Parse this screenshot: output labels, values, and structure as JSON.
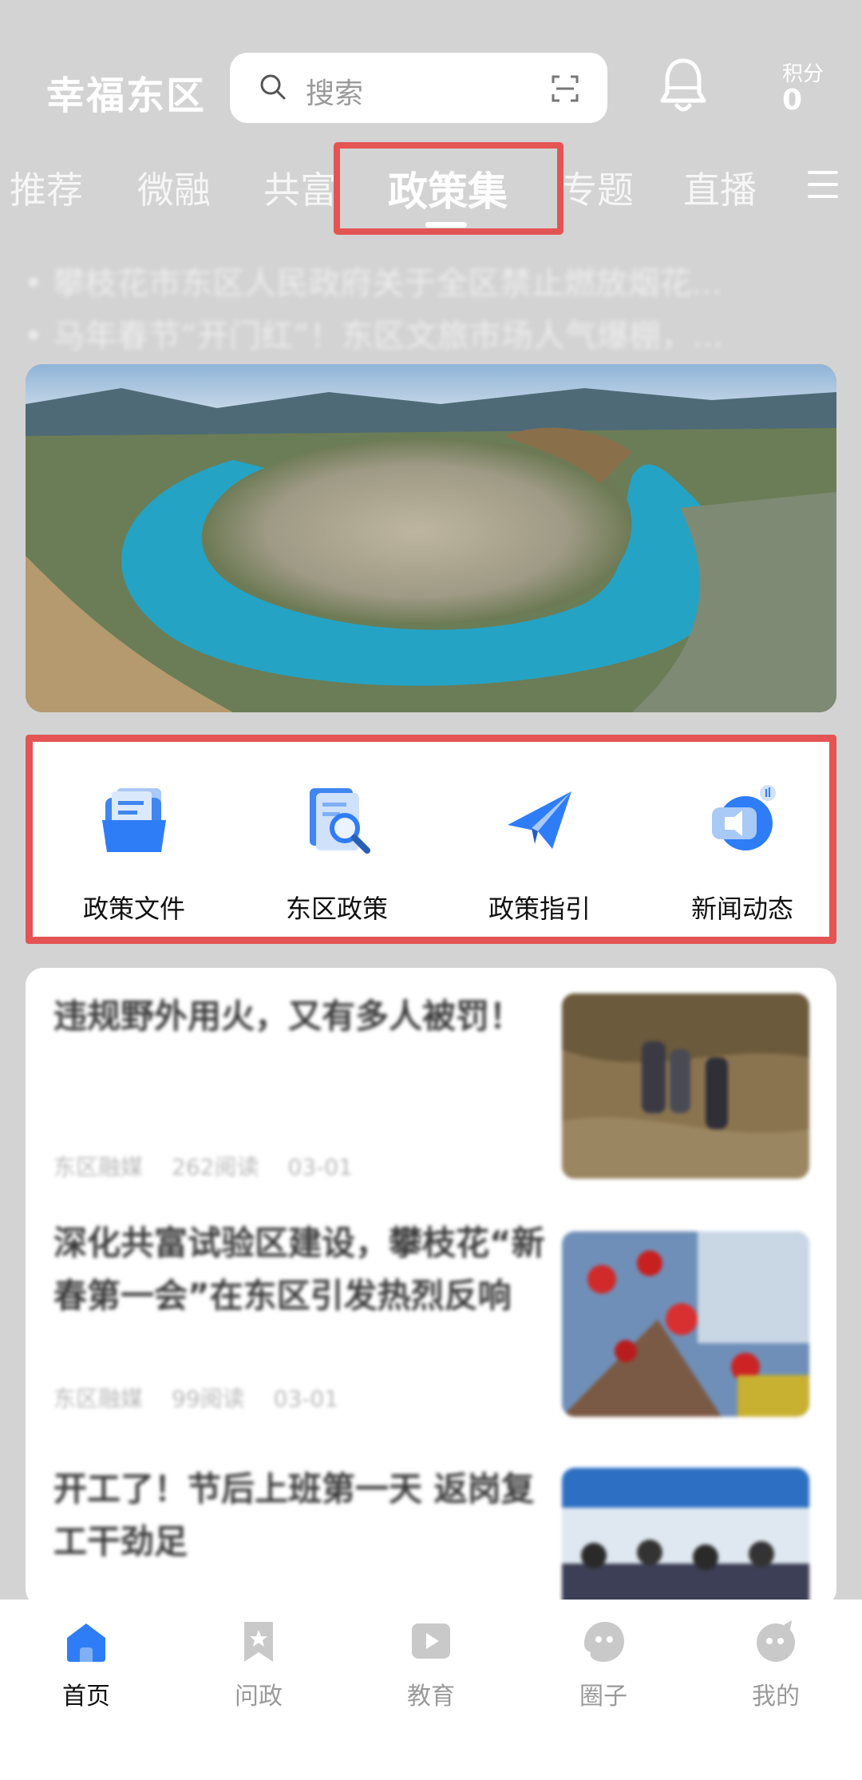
{
  "header": {
    "app_title": "幸福东区",
    "search_placeholder": "搜索",
    "points_label": "积分",
    "points_value": "0"
  },
  "tabs": [
    {
      "label": "推荐",
      "active": false
    },
    {
      "label": "微融",
      "active": false
    },
    {
      "label": "共富",
      "active": false
    },
    {
      "label": "政策集",
      "active": true
    },
    {
      "label": "专题",
      "active": false
    },
    {
      "label": "直播",
      "active": false
    }
  ],
  "ticker": [
    "攀枝花市东区人民政府关于全区禁止燃放烟花...",
    "马年春节“开门红”！东区文旅市场人气爆棚，..."
  ],
  "quick_entries": [
    {
      "label": "政策文件",
      "icon": "folder-icon"
    },
    {
      "label": "东区政策",
      "icon": "document-search-icon"
    },
    {
      "label": "政策指引",
      "icon": "paper-plane-icon"
    },
    {
      "label": "新闻动态",
      "icon": "news-speaker-icon"
    }
  ],
  "news": [
    {
      "title": "违规野外用火，又有多人被罚！",
      "source": "东区融媒",
      "reads": "262阅读",
      "date": "03-01"
    },
    {
      "title": "深化共富试验区建设，攀枝花“新春第一会”在东区引发热烈反响",
      "source": "东区融媒",
      "reads": "99阅读",
      "date": "03-01"
    },
    {
      "title": "开工了！节后上班第一天 返岗复工干劲足",
      "source": "",
      "reads": "",
      "date": ""
    }
  ],
  "bottom_nav": [
    {
      "label": "首页",
      "icon": "home-icon",
      "active": true
    },
    {
      "label": "问政",
      "icon": "bookmark-star-icon",
      "active": false
    },
    {
      "label": "教育",
      "icon": "play-icon",
      "active": false
    },
    {
      "label": "圈子",
      "icon": "circle-face-icon",
      "active": false
    },
    {
      "label": "我的",
      "icon": "profile-face-icon",
      "active": false
    }
  ],
  "colors": {
    "highlight": "#e45454",
    "accent_blue": "#2f7df6",
    "background": "#d3d3d3"
  }
}
